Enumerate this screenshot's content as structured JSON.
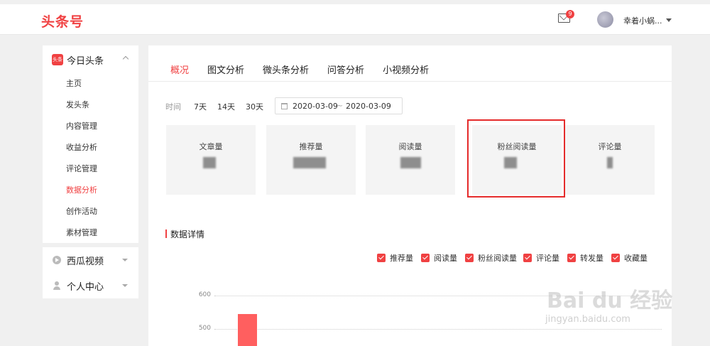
{
  "header": {
    "logo": "头条号",
    "mail_badge": "9",
    "username": "幸着小蜗..."
  },
  "sidebar": {
    "toutiao": {
      "icon_label": "头条",
      "label": "今日头条",
      "items": [
        {
          "label": "主页"
        },
        {
          "label": "发头条"
        },
        {
          "label": "内容管理"
        },
        {
          "label": "收益分析"
        },
        {
          "label": "评论管理"
        },
        {
          "label": "数据分析"
        },
        {
          "label": "创作活动"
        },
        {
          "label": "素材管理"
        }
      ],
      "active_index": 5
    },
    "xigua": {
      "label": "西瓜视频"
    },
    "personal": {
      "label": "个人中心"
    }
  },
  "main": {
    "tabs": [
      {
        "label": "概况"
      },
      {
        "label": "图文分析"
      },
      {
        "label": "微头条分析"
      },
      {
        "label": "问答分析"
      },
      {
        "label": "小视频分析"
      }
    ],
    "active_tab": 0,
    "filter": {
      "label": "时间",
      "options": [
        "7天",
        "14天",
        "30天"
      ],
      "date_start": "2020-03-09",
      "date_sep": "~",
      "date_end": "2020-03-09"
    },
    "cards": [
      {
        "label": "文章量"
      },
      {
        "label": "推荐量"
      },
      {
        "label": "阅读量"
      },
      {
        "label": "粉丝阅读量"
      },
      {
        "label": "评论量"
      }
    ],
    "highlighted_card": 3,
    "detail_title": "数据详情",
    "legend": [
      {
        "label": "推荐量"
      },
      {
        "label": "阅读量"
      },
      {
        "label": "粉丝阅读量"
      },
      {
        "label": "评论量"
      },
      {
        "label": "转发量"
      },
      {
        "label": "收藏量"
      }
    ]
  },
  "chart_data": {
    "type": "bar",
    "y_ticks": [
      "600",
      "500"
    ],
    "ylim": [
      400,
      600
    ],
    "series": [
      {
        "values": [
          545
        ]
      }
    ],
    "color": "#ff5f5f"
  },
  "watermark": {
    "main": "Bai du 经验",
    "sub": "jingyan.baidu.com"
  },
  "colors": {
    "accent": "#f04142",
    "highlight_border": "#e52b2b"
  }
}
